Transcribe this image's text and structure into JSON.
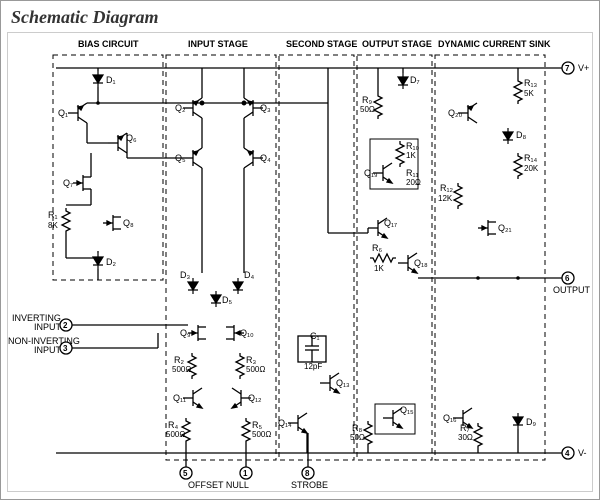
{
  "title": "Schematic Diagram",
  "sections": {
    "bias": "BIAS CIRCUIT",
    "input": "INPUT STAGE",
    "second": "SECOND STAGE",
    "output": "OUTPUT STAGE",
    "sink": "DYNAMIC CURRENT SINK"
  },
  "pins": {
    "n1": "1",
    "n2": "2",
    "n3": "3",
    "n4": "4",
    "n5": "5",
    "n6": "6",
    "n7": "7",
    "n8": "8",
    "offset": "OFFSET NULL",
    "strobe": "STROBE",
    "inv": "INVERTING",
    "ninv": "NON-INVERTING",
    "inp": "INPUT",
    "vplus": "V+",
    "vminus": "V-",
    "out": "OUTPUT"
  },
  "parts": {
    "D1": "D₁",
    "D2": "D₂",
    "D3": "D₃",
    "D4": "D₄",
    "D5": "D₅",
    "D7": "D₇",
    "D8": "D₈",
    "D9": "D₉",
    "Q1": "Q₁",
    "Q2": "Q₂",
    "Q3": "Q₃",
    "Q4": "Q₄",
    "Q5": "Q₅",
    "Q6": "Q₆",
    "Q7": "Q₇",
    "Q8": "Q₈",
    "Q9": "Q₉",
    "Q10": "Q₁₀",
    "Q11": "Q₁₁",
    "Q12": "Q₁₂",
    "Q13": "Q₁₃",
    "Q14": "Q₁₄",
    "Q15": "Q₁₅",
    "Q16": "Q₁₆",
    "Q17": "Q₁₇",
    "Q18": "Q₁₈",
    "Q19": "Q₁₉",
    "Q20": "Q₂₀",
    "Q21": "Q₂₁",
    "R1": "R₁",
    "R2": "R₂",
    "R3": "R₃",
    "R4": "R₄",
    "R5": "R₅",
    "R6": "R₆",
    "R7": "R₇",
    "R8": "R₈",
    "R9": "R₉",
    "R10": "R₁₀",
    "R11": "R₁₁",
    "R12": "R₁₂",
    "R13": "R₁₃",
    "R14": "R₁₄",
    "C1": "C₁"
  },
  "values": {
    "R1": "8K",
    "R2": "500Ω",
    "R3": "500Ω",
    "R4": "500Ω",
    "R5": "500Ω",
    "R6": "1K",
    "R7": "30Ω",
    "R8": "50Ω",
    "R9": "50Ω",
    "R10": "1K",
    "R11": "20Ω",
    "R12": "12K",
    "R13": "5K",
    "R14": "20K",
    "C1": "12pF"
  }
}
